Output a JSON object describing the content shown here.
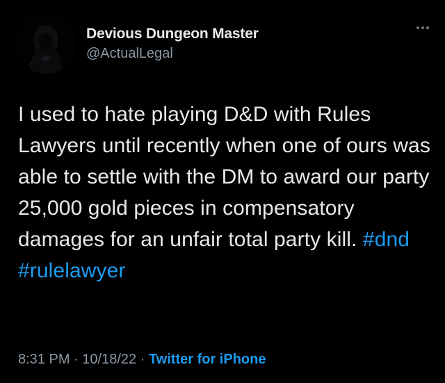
{
  "tweet": {
    "author": {
      "display_name": "Devious Dungeon Master",
      "handle": "@ActualLegal",
      "avatar_icon": "hooded-figure-avatar"
    },
    "more_icon": "ellipsis-icon",
    "text_segments": [
      "I used to hate playing D&D with Rules Lawyers until recently when one of ours was able to settle with the DM to award our party 25,000 gold pieces in compensatory damages for an unfair total party kill. ",
      "#dnd",
      " ",
      "#rulelawyer"
    ],
    "meta": {
      "time": "8:31 PM",
      "separator": "·",
      "date": "10/18/22",
      "source": "Twitter for iPhone"
    }
  },
  "colors": {
    "background": "#000000",
    "text": "#e7e9ea",
    "secondary": "#8b98a5",
    "accent": "#1d9bf0"
  }
}
